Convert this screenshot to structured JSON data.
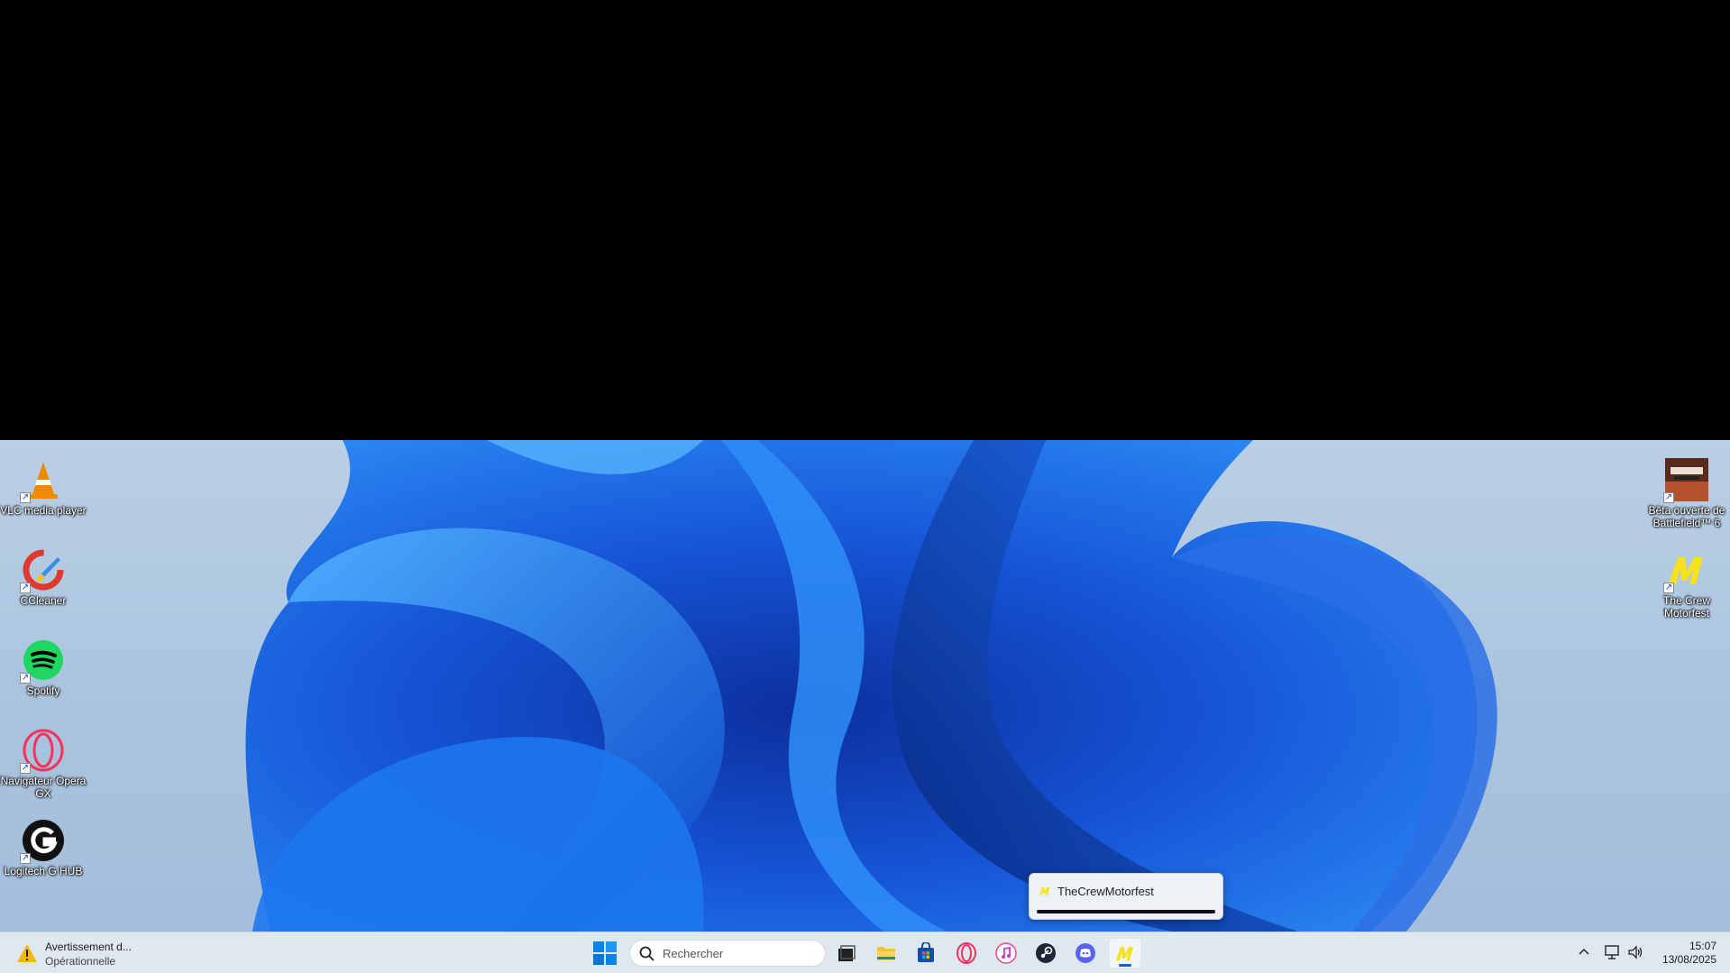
{
  "desktop": {
    "icons_left": [
      {
        "label": "VLC media player",
        "icon": "vlc-icon"
      },
      {
        "label": "CCleaner",
        "icon": "ccleaner-icon"
      },
      {
        "label": "Spotify",
        "icon": "spotify-icon"
      },
      {
        "label": "Navigateur Opera GX",
        "icon": "opera-gx-icon"
      },
      {
        "label": "Logitech G HUB",
        "icon": "logitech-ghub-icon"
      }
    ],
    "icons_right": [
      {
        "label": "Bêta ouverte de Battlefield™ 6",
        "icon": "battlefield-icon"
      },
      {
        "label": "The Crew Motorfest",
        "icon": "crew-motorfest-icon"
      }
    ]
  },
  "preview": {
    "title": "TheCrewMotorfest",
    "icon": "crew-motorfest-icon"
  },
  "taskbar": {
    "notification": {
      "title": "Avertissement d...",
      "status": "Opérationnelle",
      "icon": "warning-icon"
    },
    "search_placeholder": "Rechercher",
    "apps": [
      {
        "name": "task-view",
        "icon": "task-view-icon"
      },
      {
        "name": "file-explorer",
        "icon": "folder-icon"
      },
      {
        "name": "microsoft-store",
        "icon": "store-icon"
      },
      {
        "name": "opera-gx",
        "icon": "opera-icon"
      },
      {
        "name": "itunes",
        "icon": "itunes-icon"
      },
      {
        "name": "steam",
        "icon": "steam-icon"
      },
      {
        "name": "discord",
        "icon": "discord-icon"
      },
      {
        "name": "the-crew-motorfest",
        "icon": "crew-motorfest-icon",
        "active": true
      }
    ],
    "clock": {
      "time": "15:07",
      "date": "13/08/2025"
    }
  },
  "colors": {
    "accent": "#0a64c8",
    "taskbar_bg": "#dfe7f1",
    "motorfest_yellow": "#f5e21a"
  }
}
